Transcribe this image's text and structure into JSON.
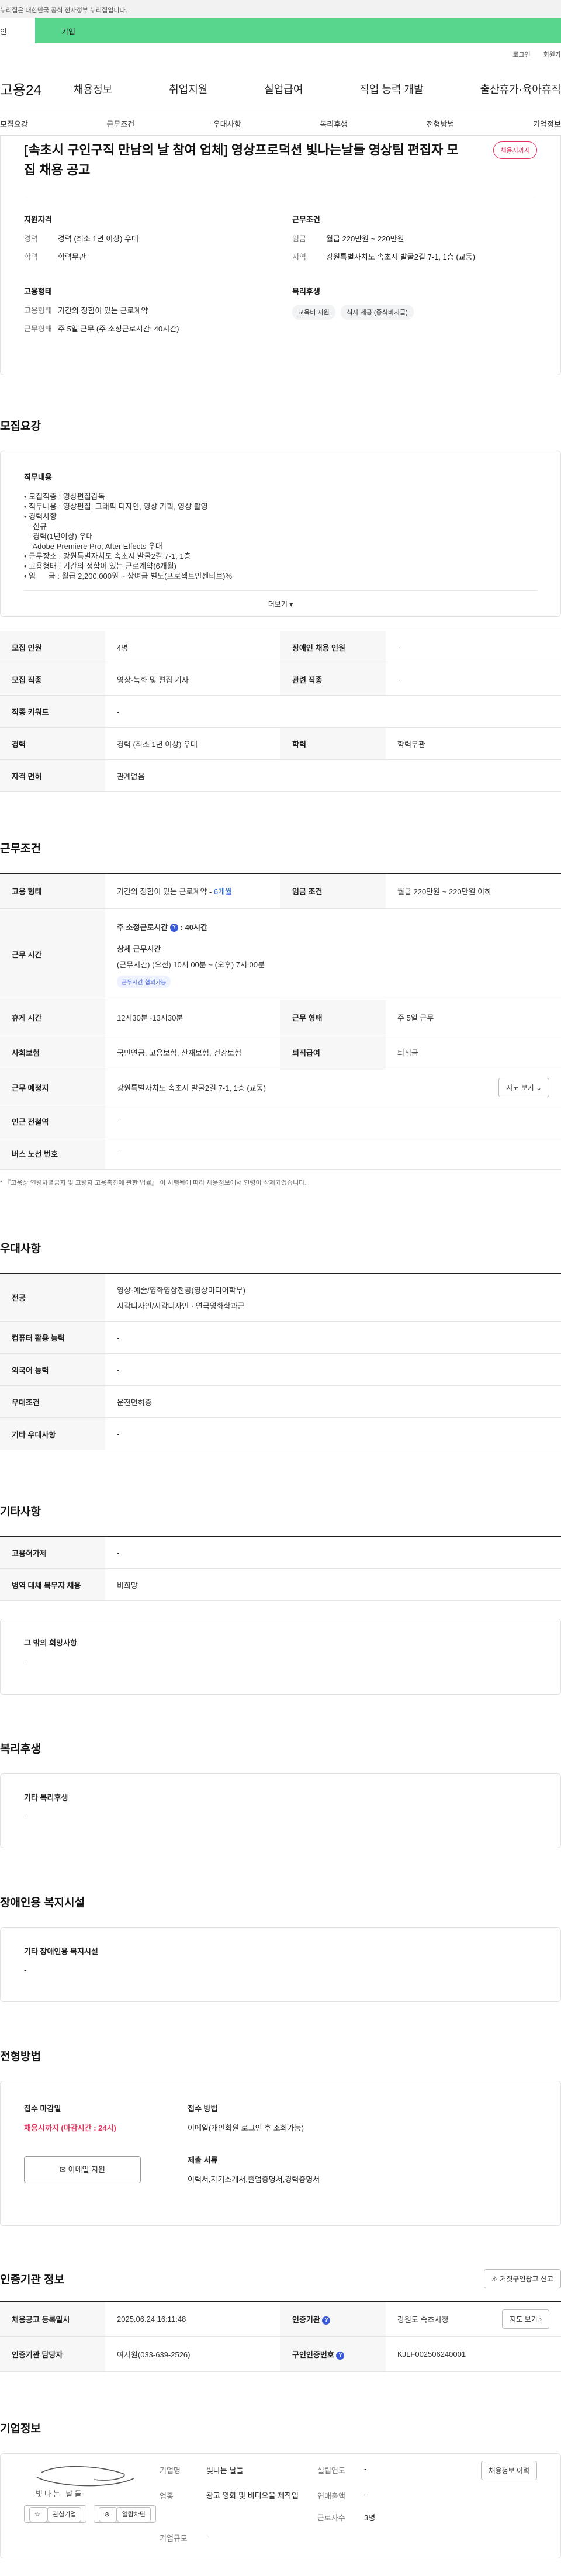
{
  "gov_banner": "누리집은 대한민국 공식 전자정부 누리집입니다.",
  "tabs": {
    "left": "인",
    "right": "기업"
  },
  "util": {
    "login": "로그인",
    "join": "회원가"
  },
  "gnb": {
    "logo": "고용24",
    "items": [
      "채용정보",
      "취업지원",
      "실업급여",
      "직업 능력 개발",
      "출산휴가·육아휴직"
    ]
  },
  "anchors": [
    "모집요강",
    "근무조건",
    "우대사항",
    "복리후생",
    "전형방법",
    "기업정보"
  ],
  "summary": {
    "title": "[속초시 구인구직 만남의 날 참여 업체] 영상프로덕션 빛나는날들 영상팀 편집자 모집 채용 공고",
    "status": "채용시까지",
    "qual_title": "지원자격",
    "career_k": "경력",
    "career_v": "경력 (최소 1년 이상) 우대",
    "edu_k": "학력",
    "edu_v": "학력무관",
    "cond_title": "근무조건",
    "wage_k": "임금",
    "wage_v": "월급 220만원 ~ 220만원",
    "area_k": "지역",
    "area_v": "강원특별자치도 속초시 발굴2길 7-1, 1층 (교동)",
    "emp_title": "고용형태",
    "emp_k": "고용형태",
    "emp_v": "기간의 정함이 있는 근로계약",
    "hours_k": "근무형태",
    "hours_v": "주 5일 근무 (주 소정근로시간: 40시간)",
    "welfare_title": "복리후생",
    "welfare_chips": [
      "교육비 지원",
      "식사 제공 (중식비지급)"
    ]
  },
  "recruit": {
    "title": "모집요강",
    "duty_title": "직무내용",
    "lines": [
      "• 모집직종 : 영상편집감독",
      "• 직무내용 : 영상편집, 그래픽 디자인, 영상 기획, 영상 촬영",
      "• 경력사항",
      "  - 신규",
      "  - 경력(1년이상) 우대",
      "  - Adobe Premiere Pro, After Effects 우대",
      "• 근무장소 : 강원특별자치도 속초시 발굴2길 7-1, 1층",
      "• 고용형태 : 기간의 정함이 있는 근로계약(6개월)",
      "• 임      금 : 월급 2,200,000원 ~ 상여금 별도(프로젝트인센티브)%"
    ],
    "more": "더보기",
    "rows": {
      "headcount_k": "모집 인원",
      "headcount_v": "4명",
      "disabled_k": "장애인 채용 인원",
      "disabled_v": "-",
      "job_k": "모집 직종",
      "job_v": "영상·녹화 및 편집 기사",
      "related_k": "관련 직종",
      "related_v": "-",
      "keyword_k": "직종 키워드",
      "keyword_v": "-",
      "career_k": "경력",
      "career_v": "경력 (최소 1년 이상) 우대",
      "edu_k": "학력",
      "edu_v": "학력무관",
      "license_k": "자격 면허",
      "license_v": "관계없음"
    }
  },
  "conditions": {
    "title": "근무조건",
    "emp_k": "고용 형태",
    "emp_v": "기간의 정함이 있는 근로계약 - ",
    "emp_months": "6개월",
    "wage_k": "임금 조건",
    "wage_v": "월급 220만원 ~ 220만원 이하",
    "time_k": "근무 시간",
    "week_hours": "주 소정근로시간",
    "week_hours_v": ": 40시간",
    "detail_title": "상세 근무시간",
    "detail_v": "(근무시간) (오전) 10시 00분 ~ (오후) 7시 00분",
    "detail_chip": "근무시간 협의가능",
    "rest_k": "휴게 시간",
    "rest_v": "12시30분~13시30분",
    "type_k": "근무 형태",
    "type_v": "주 5일 근무",
    "insurance_k": "사회보험",
    "insurance_v": "국민연금, 고용보험, 산재보험, 건강보험",
    "retire_k": "퇴직급여",
    "retire_v": "퇴직금",
    "place_k": "근무 예정지",
    "place_v": "강원특별자치도 속초시 발굴2길 7-1, 1층 (교동)",
    "map_btn": "지도 보기",
    "subway_k": "인근 전철역",
    "subway_v": "-",
    "bus_k": "버스 노선 번호",
    "bus_v": "-",
    "note": "* 『고용상 연령차별금지 및 고령자 고용촉진에 관한 법률』 이 시행됨에 따라 채용정보에서 연령이 삭제되었습니다."
  },
  "prefer": {
    "title": "우대사항",
    "major_k": "전공",
    "major_v1": "영상·예술/영화영상전공(영상미디어학부)",
    "major_v2": "시각디자인/시각디자인 · 연극영화학과군",
    "pc_k": "컴퓨터 활용 능력",
    "pc_v": "-",
    "lang_k": "외국어 능력",
    "lang_v": "-",
    "cond_k": "우대조건",
    "cond_v": "운전면허증",
    "etc_k": "기타 우대사항",
    "etc_v": "-"
  },
  "etc": {
    "title": "기타사항",
    "emp_ins_k": "고용허가제",
    "emp_ins_v": "-",
    "military_k": "병역 대체 복무자 채용",
    "military_v": "비희망",
    "other_title": "그 밖의 희망사항",
    "other_v": "-"
  },
  "welfare": {
    "title": "복리후생",
    "card_title": "기타 복리후생",
    "card_v": "-"
  },
  "disabled": {
    "title": "장애인용 복지시설",
    "card_title": "기타 장애인용 복지시설",
    "card_v": "-"
  },
  "apply": {
    "title": "전형방법",
    "deadline_title": "접수 마감일",
    "deadline_v": "채용시까지 (마감시간 : 24시)",
    "method_title": "접수 방법",
    "method_v": "이메일(개인회원 로그인 후 조회가능)",
    "docs_title": "제출 서류",
    "docs_v": "이력서,자기소개서,졸업증명서,경력증명서",
    "email_btn": "이메일 지원"
  },
  "auth": {
    "title": "인증기관 정보",
    "report_btn": "거짓구인광고 신고",
    "reg_k": "채용공고 등록일시",
    "reg_v": "2025.06.24 16:11:48",
    "org_k": "인증기관",
    "org_v": "강원도 속초시청",
    "map_btn": "지도 보기",
    "mgr_k": "인증기관 담당자",
    "mgr_v": "여자원(033-639-2526)",
    "no_k": "구인인증번호",
    "no_v": "KJLF002506240001"
  },
  "company": {
    "title": "기업정보",
    "logo_text": "빛나는 날들",
    "fav_btn": "관심기업",
    "block_btn": "열람차단",
    "name_k": "기업명",
    "name_v": "빛나는 날들",
    "founded_k": "설립연도",
    "founded_v": "-",
    "industry_k": "업종",
    "industry_v": "광고 영화 및 비디오물 제작업",
    "revenue_k": "연매출액",
    "revenue_v": "-",
    "staff_k": "근로자수",
    "staff_v": "3명",
    "scale_k": "기업규모",
    "scale_v": "-",
    "view_btn": "채용정보 이력"
  }
}
